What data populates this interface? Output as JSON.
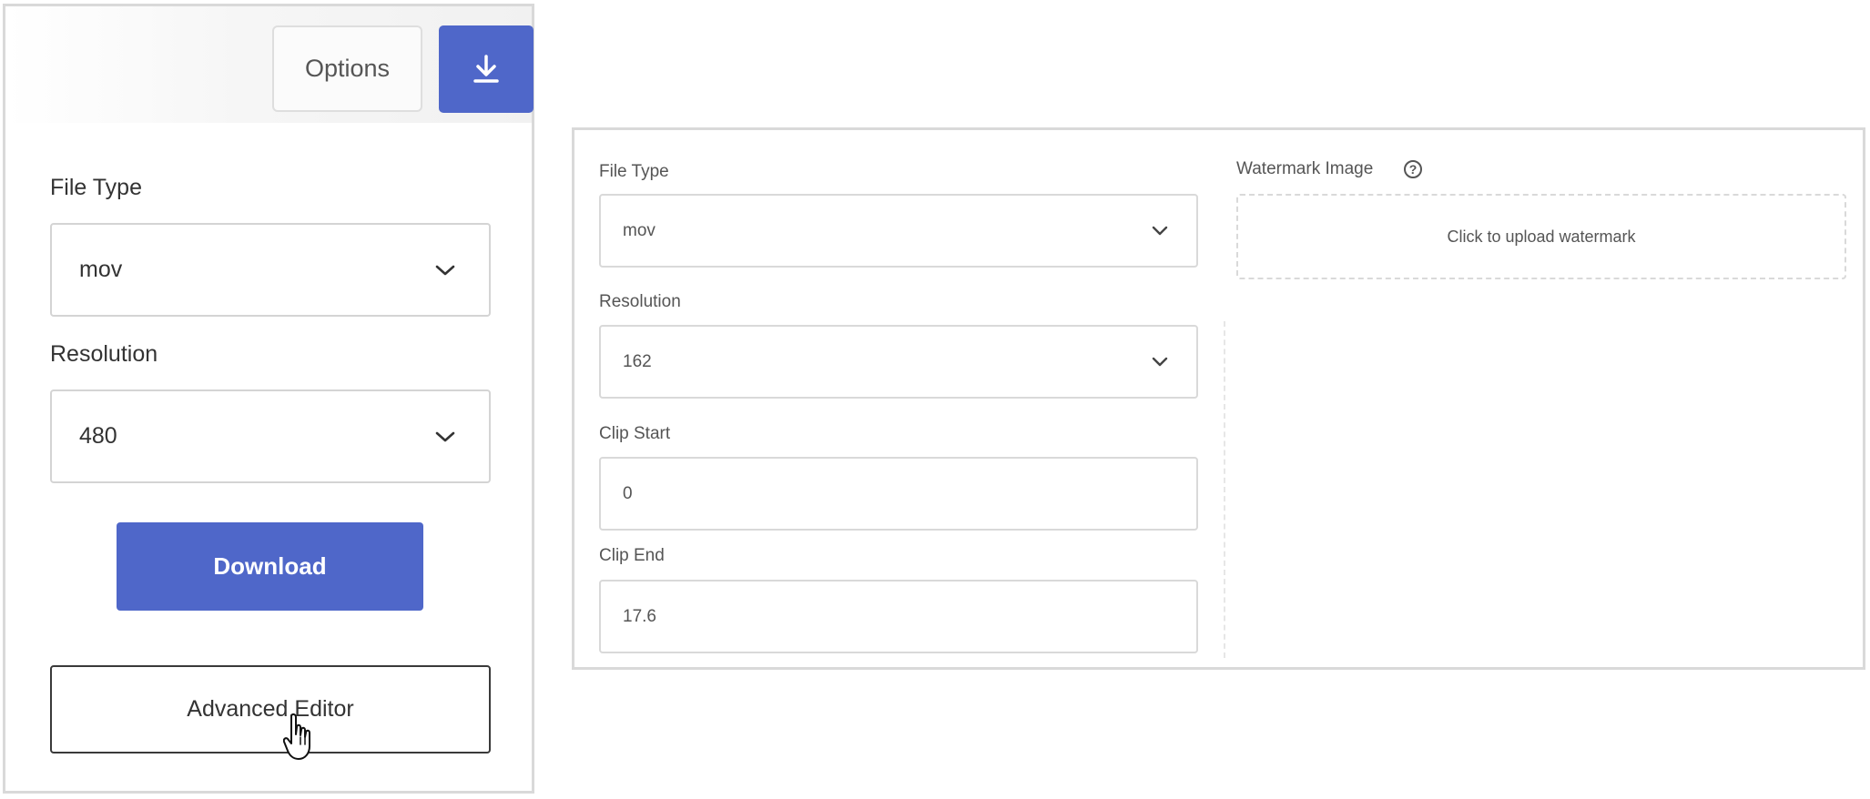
{
  "left": {
    "options_label": "Options",
    "download_icon": "download-icon",
    "file_type": {
      "label": "File Type",
      "value": "mov"
    },
    "resolution": {
      "label": "Resolution",
      "value": "480"
    },
    "download_label": "Download",
    "advanced_editor_label": "Advanced Editor"
  },
  "right": {
    "file_type": {
      "label": "File Type",
      "value": "mov"
    },
    "resolution": {
      "label": "Resolution",
      "value": "162"
    },
    "clip_start": {
      "label": "Clip Start",
      "value": "0"
    },
    "clip_end": {
      "label": "Clip End",
      "value": "17.6"
    },
    "watermark": {
      "label": "Watermark Image",
      "help_glyph": "?",
      "upload_text": "Click to upload watermark"
    }
  },
  "colors": {
    "accent": "#4f67c9",
    "border": "#d9d9d9",
    "text": "#333333"
  }
}
